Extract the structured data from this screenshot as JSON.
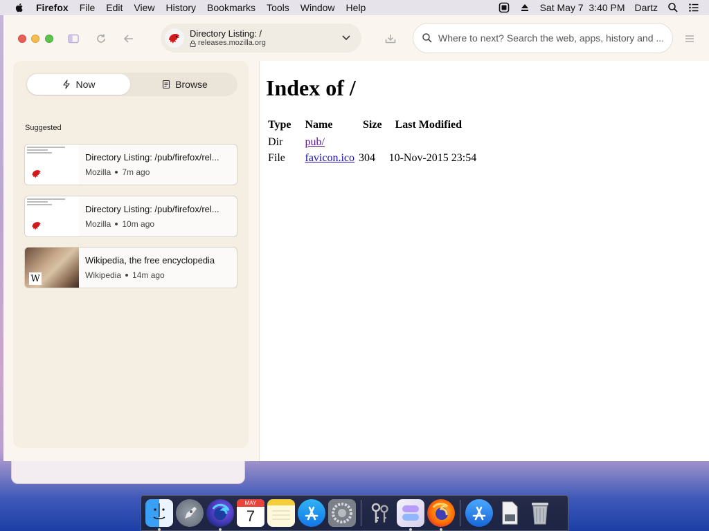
{
  "menubar": {
    "app_name": "Firefox",
    "items": [
      "File",
      "Edit",
      "View",
      "History",
      "Bookmarks",
      "Tools",
      "Window",
      "Help"
    ],
    "clock": "Sat May 7  3:40 PM",
    "user": "Dartz"
  },
  "toolbar": {
    "tab_title": "Directory Listing: /",
    "tab_domain": "releases.mozilla.org",
    "search_placeholder": "Where to next? Search the web, apps, history and ..."
  },
  "sidebar": {
    "tabs": [
      {
        "label": "Now",
        "icon": "lightning-icon",
        "active": true
      },
      {
        "label": "Browse",
        "icon": "document-icon",
        "active": false
      }
    ],
    "section_label": "Suggested",
    "cards": [
      {
        "title": "Directory Listing: /pub/firefox/rel...",
        "source": "Mozilla",
        "time": "7m ago"
      },
      {
        "title": "Directory Listing: /pub/firefox/rel...",
        "source": "Mozilla",
        "time": "10m ago"
      },
      {
        "title": "Wikipedia, the free encyclopedia",
        "source": "Wikipedia",
        "time": "14m ago"
      }
    ]
  },
  "page": {
    "heading": "Index of /",
    "columns": [
      "Type",
      "Name",
      "Size",
      "Last Modified"
    ],
    "rows": [
      {
        "type": "Dir",
        "name": "pub/",
        "size": "",
        "modified": ""
      },
      {
        "type": "File",
        "name": "favicon.ico",
        "size": "304",
        "modified": "10-Nov-2015 23:54"
      }
    ]
  },
  "dock": {
    "calendar_month": "MAY",
    "calendar_day": "7"
  },
  "colors": {
    "accent_red": "#d11a1a",
    "link": "#1a0dab",
    "visited_link": "#551a8b"
  }
}
